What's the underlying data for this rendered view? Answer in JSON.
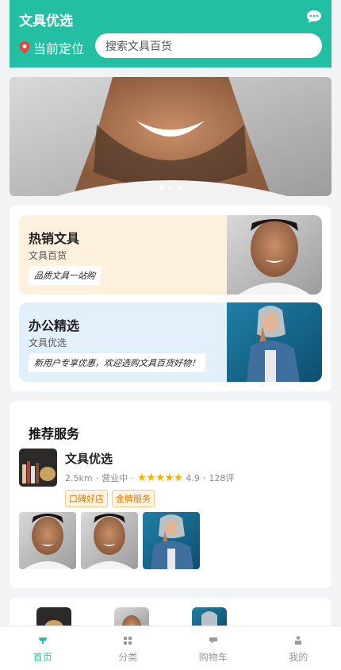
{
  "header": {
    "title": "文具优选",
    "location_label": "当前定位",
    "search_placeholder": "搜索文具百货"
  },
  "banner": {
    "dots": 3,
    "active_dot": 1
  },
  "promos": [
    {
      "title": "热销文具",
      "subtitle": "文具百货",
      "tag": "品质文具一站购",
      "bg": "#fdf0dd"
    },
    {
      "title": "办公精选",
      "subtitle": "文具优选",
      "tag": "新用户专享优惠，欢迎选购文具百货好物！",
      "bg": "#e2f0fc"
    }
  ],
  "recommend": {
    "title": "推荐服务",
    "shop": {
      "name": "文具优选",
      "distance": "2.5km",
      "status": "营业中",
      "stars": "★★★★★",
      "rating": "4.9",
      "reviews": "128评",
      "badges": [
        "口碑好店",
        "金牌服务"
      ]
    }
  },
  "tabs": [
    {
      "label": "首页",
      "icon": "home-icon",
      "active": true
    },
    {
      "label": "分类",
      "icon": "grid-icon",
      "active": false
    },
    {
      "label": "购物车",
      "icon": "cart-icon",
      "active": false
    },
    {
      "label": "我的",
      "icon": "user-icon",
      "active": false
    }
  ],
  "colors": {
    "brand": "#22bfa2",
    "star": "#f5b400"
  }
}
